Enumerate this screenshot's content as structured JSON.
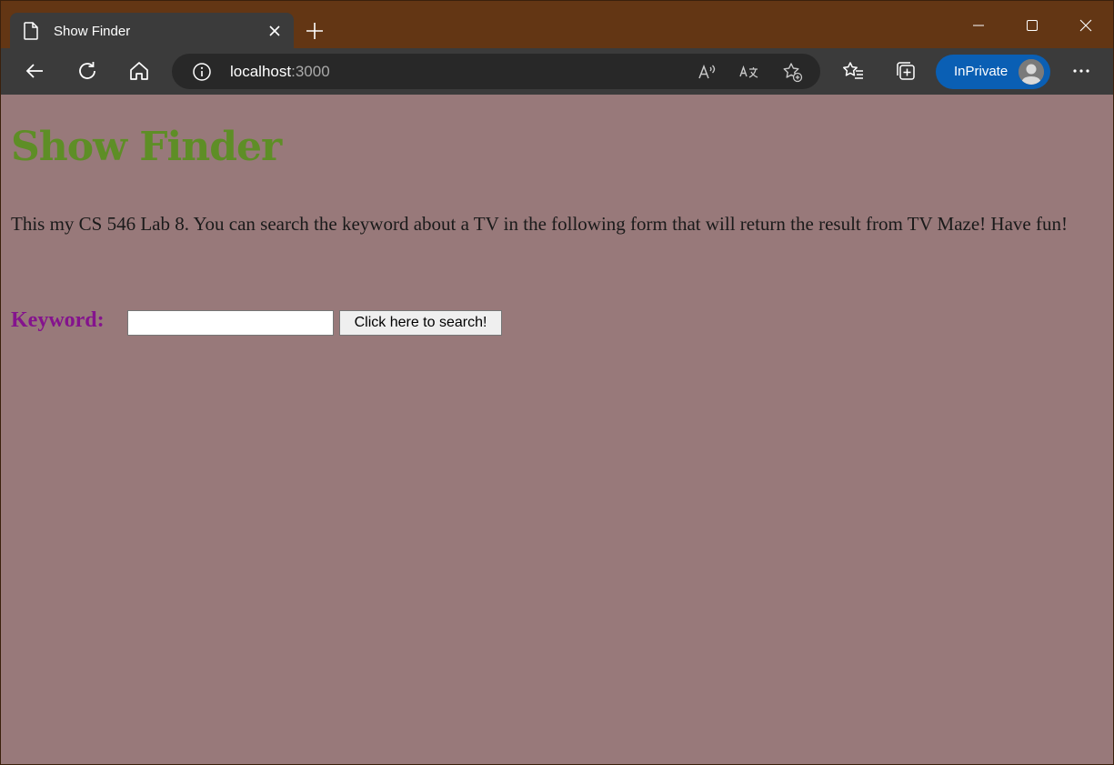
{
  "browser": {
    "tab_title": "Show Finder",
    "url_host": "localhost",
    "url_port": ":3000",
    "inprivate_label": "InPrivate"
  },
  "page": {
    "title": "Show Finder",
    "intro": "This my CS 546 Lab 8. You can search the keyword about a TV in the following form that will return the result from TV Maze! Have fun!",
    "form": {
      "keyword_label": "Keyword:",
      "keyword_value": "",
      "search_button": "Click here to search!"
    }
  },
  "colors": {
    "window_frame": "#633614",
    "page_background": "#98797a",
    "title_color": "#5e8e26",
    "label_color": "#84138d",
    "inprivate_badge": "#0a5fb4"
  },
  "icons": [
    "page-icon",
    "close-icon",
    "plus-icon",
    "minimize-icon",
    "maximize-icon",
    "window-close-icon",
    "back-arrow-icon",
    "refresh-icon",
    "home-icon",
    "info-icon",
    "read-aloud-icon",
    "translate-icon",
    "add-favorite-icon",
    "favorites-icon",
    "collections-icon",
    "avatar-icon",
    "more-icon"
  ]
}
